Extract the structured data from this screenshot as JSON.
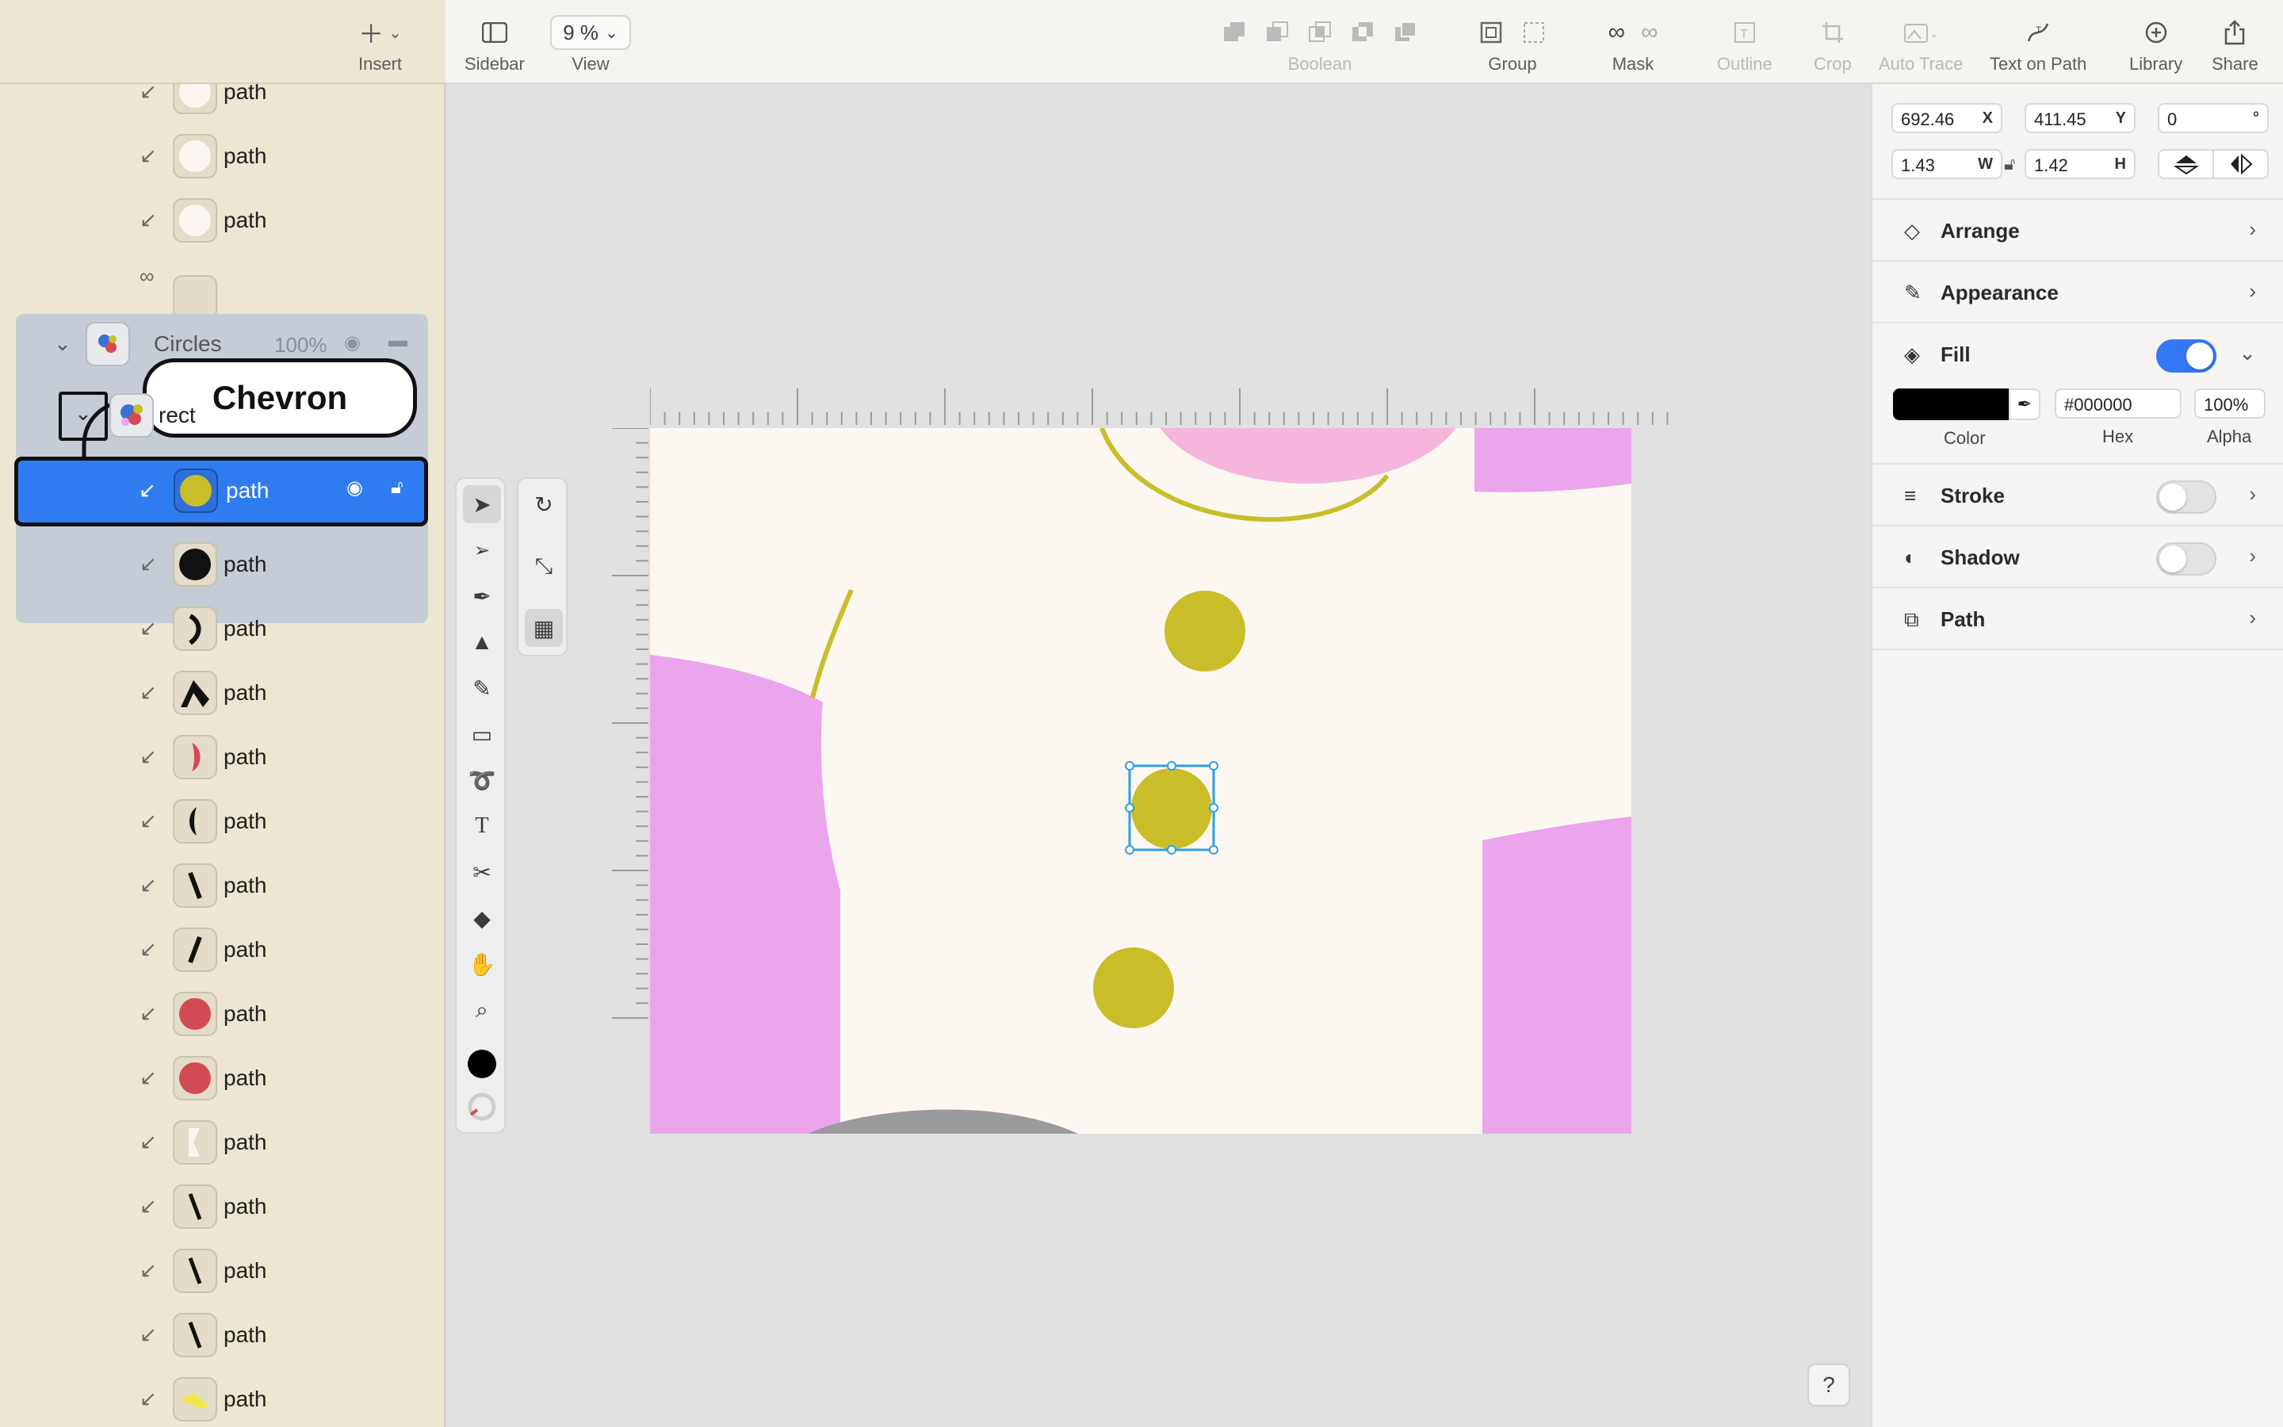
{
  "toolbar": {
    "insert_label": "Insert",
    "sidebar_label": "Sidebar",
    "zoom_value": "9 %",
    "view_label": "View",
    "boolean_label": "Boolean",
    "group_label": "Group",
    "mask_label": "Mask",
    "outline_label": "Outline",
    "crop_label": "Crop",
    "autotrace_label": "Auto Trace",
    "textonpath_label": "Text on Path",
    "library_label": "Library",
    "share_label": "Share"
  },
  "sidebar": {
    "callout": "Chevron",
    "group_name": "Circles",
    "group_opacity": "100%",
    "subgroup_name": "rect",
    "top_rows": [
      "path",
      "path",
      "path"
    ],
    "selected_row": "path",
    "rows": [
      "path",
      "path",
      "path",
      "path",
      "path",
      "path",
      "path",
      "path",
      "path",
      "path",
      "path",
      "path",
      "path",
      "path"
    ]
  },
  "inspector": {
    "x_value": "692.46",
    "x_suffix": "X",
    "y_value": "411.45",
    "y_suffix": "Y",
    "rot_value": "0",
    "rot_suffix": "°",
    "w_value": "1.43",
    "w_suffix": "W",
    "h_value": "1.42",
    "h_suffix": "H",
    "sections": {
      "arrange": "Arrange",
      "appearance": "Appearance",
      "fill": "Fill",
      "stroke": "Stroke",
      "shadow": "Shadow",
      "path": "Path"
    },
    "fill": {
      "enabled": true,
      "hex": "#000000",
      "alpha": "100%",
      "color_label": "Color",
      "hex_label": "Hex",
      "alpha_label": "Alpha"
    },
    "stroke_enabled": false,
    "shadow_enabled": false
  },
  "help_label": "?",
  "colors": {
    "accent": "#3478f6",
    "selection": "#2f7cf0",
    "olive": "#c9bd2a",
    "pink": "#eba5ec",
    "cream": "#fdf7f2",
    "red": "#d44a52"
  }
}
